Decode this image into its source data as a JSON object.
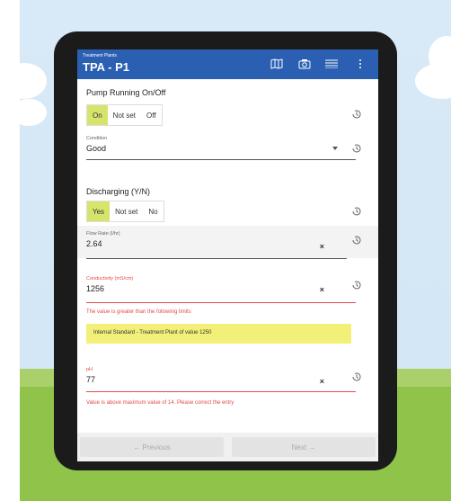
{
  "app": {
    "subtitle": "Treatment Plants",
    "title": "TPA - P1"
  },
  "toolbar_icons": [
    "map-icon",
    "camera-icon",
    "barcode-icon",
    "more-vert-icon"
  ],
  "pump_running": {
    "label": "Pump Running On/Off",
    "options": [
      "On",
      "Not set",
      "Off"
    ],
    "selected": "On"
  },
  "condition": {
    "label": "Condition",
    "value": "Good"
  },
  "discharging": {
    "label": "Discharging (Y/N)",
    "options": [
      "Yes",
      "Not set",
      "No"
    ],
    "selected": "Yes"
  },
  "flow_rate": {
    "label": "Flow Rate (l/hr)",
    "value": "2.64",
    "clear": "×"
  },
  "conductivity": {
    "label": "Conductivity (mS/cm)",
    "value": "1256",
    "clear": "×",
    "error": "The value is greater than the following limits",
    "limit_notice": "Internal Standard - Treatment Plant of value 1250"
  },
  "ph": {
    "label": "pH",
    "value": "77",
    "clear": "×",
    "error": "Value is above maximum value of 14. Please correct the entry"
  },
  "footer": {
    "previous": "←  Previous",
    "next": "Next  →"
  },
  "colors": {
    "appbar": "#2a5fb2",
    "selected": "#d7e46c",
    "error": "#e34a4a",
    "warning": "#f3f07a"
  }
}
